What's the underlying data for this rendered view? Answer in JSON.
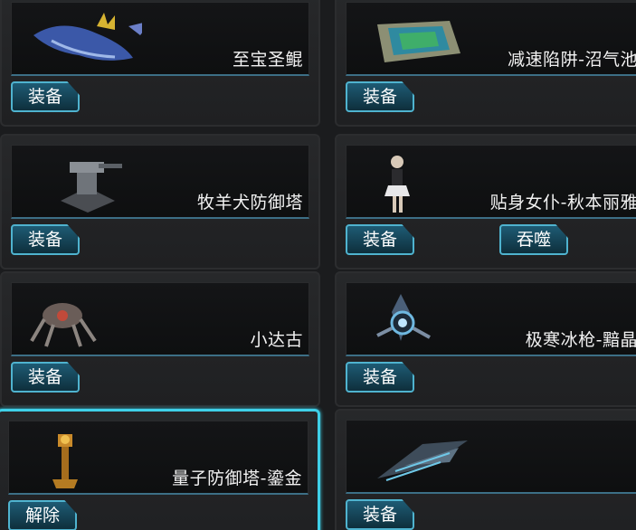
{
  "items": [
    {
      "name": "至宝圣鲲",
      "button": "装备",
      "icon": "whale-icon"
    },
    {
      "name": "减速陷阱-沼气池",
      "button": "装备",
      "icon": "trap-icon"
    },
    {
      "name": "牧羊犬防御塔",
      "button": "装备",
      "icon": "turret-icon"
    },
    {
      "name": "贴身女仆-秋本丽雅",
      "button": "装备",
      "second_button": "吞噬",
      "icon": "maid-icon"
    },
    {
      "name": "小达古",
      "button": "装备",
      "icon": "spider-mech-icon"
    },
    {
      "name": "极寒冰枪-黯晶",
      "button": "装备",
      "icon": "ice-lance-icon"
    },
    {
      "name": "量子防御塔-鎏金",
      "button": "解除",
      "icon": "golden-tower-icon",
      "selected": true
    },
    {
      "name": "",
      "button": "装备",
      "icon": "fighter-ship-icon"
    }
  ]
}
